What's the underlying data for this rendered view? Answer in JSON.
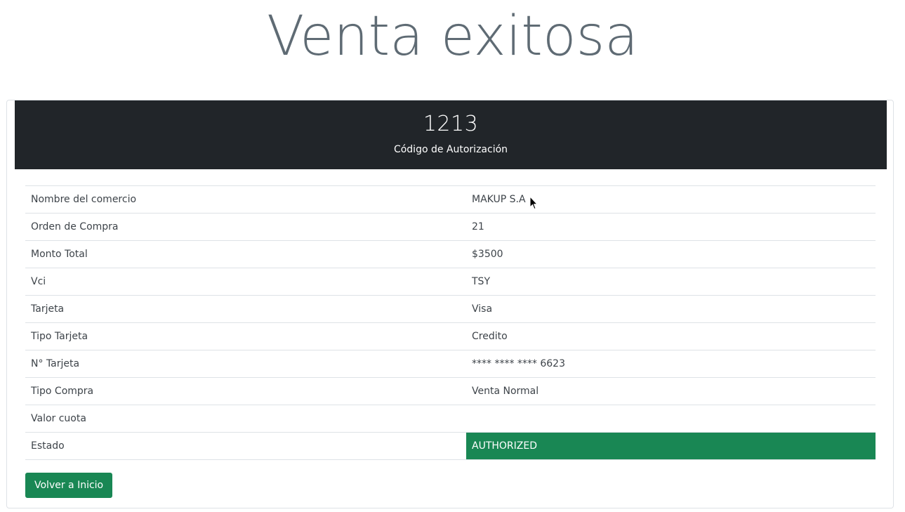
{
  "page": {
    "title": "Venta exitosa"
  },
  "header": {
    "authorization_code": "1213",
    "authorization_label": "Código de Autorización"
  },
  "details": [
    {
      "label": "Nombre del comercio",
      "value": "MAKUP S.A"
    },
    {
      "label": "Orden de Compra",
      "value": "21"
    },
    {
      "label": "Monto Total",
      "value": "$3500"
    },
    {
      "label": "Vci",
      "value": "TSY"
    },
    {
      "label": "Tarjeta",
      "value": "Visa"
    },
    {
      "label": "Tipo Tarjeta",
      "value": "Credito"
    },
    {
      "label": "N° Tarjeta",
      "value": "**** **** **** 6623"
    },
    {
      "label": "Tipo Compra",
      "value": "Venta Normal"
    },
    {
      "label": "Valor cuota",
      "value": ""
    },
    {
      "label": "Estado",
      "value": "AUTHORIZED"
    }
  ],
  "actions": {
    "back_label": "Volver a Inicio"
  },
  "colors": {
    "header_bg": "#212529",
    "success": "#198754"
  },
  "icons": {
    "cursor": "mouse-pointer-icon"
  }
}
